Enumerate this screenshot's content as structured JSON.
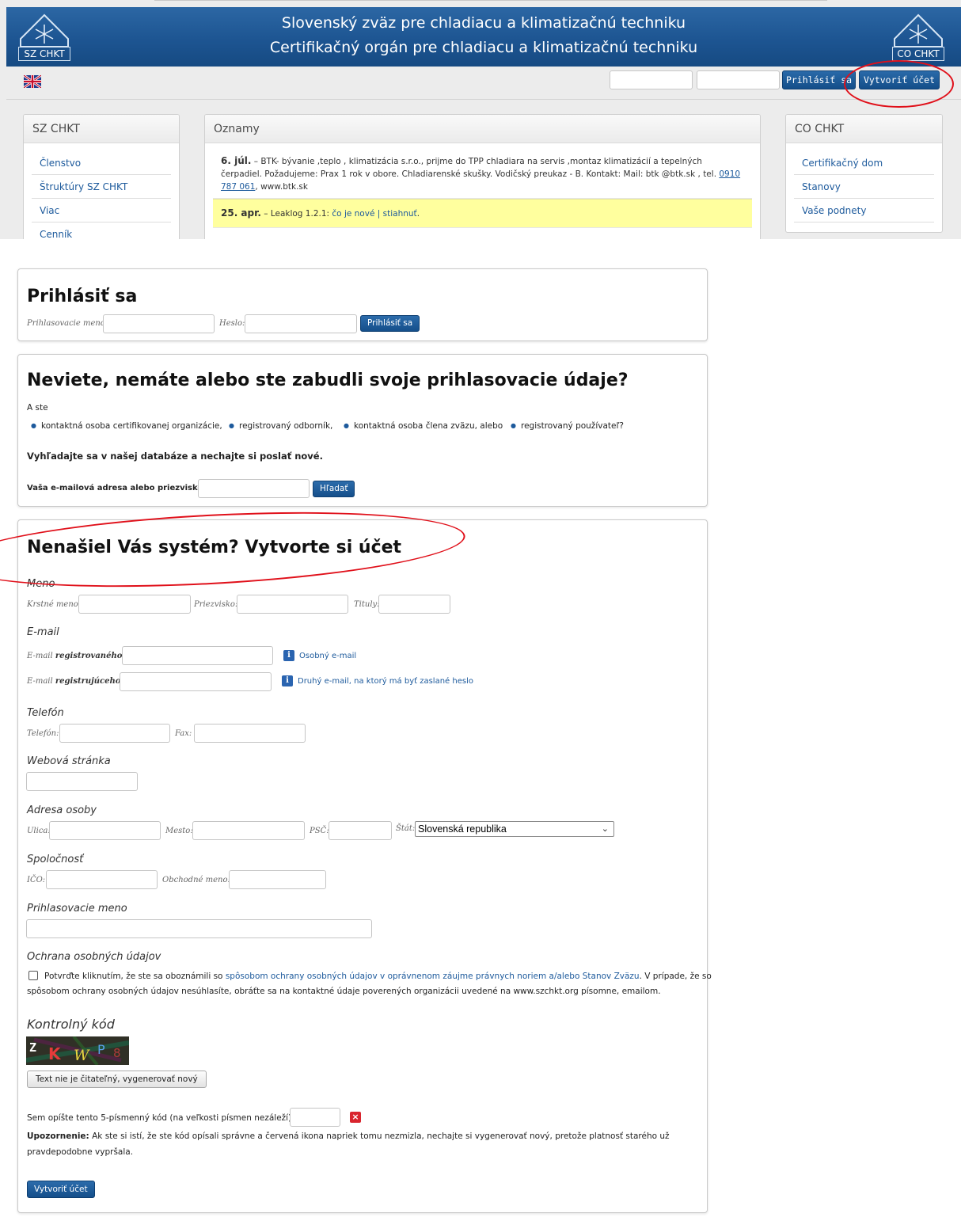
{
  "header": {
    "title_line1": "Slovenský zväz pre chladiacu a klimatizačnú techniku",
    "title_line2": "Certifikačný orgán pre chladiacu a klimatizačnú techniku",
    "logo_left_label": "SZ CHKT",
    "logo_right_label": "CO CHKT",
    "login_button": "Prihlásiť sa",
    "create_account_button": "Vytvoriť účet"
  },
  "sidebar_left": {
    "title": "SZ CHKT",
    "items": [
      "Členstvo",
      "Štruktúry SZ CHKT",
      "Viac",
      "Cenník"
    ]
  },
  "news": {
    "title": "Oznamy",
    "item1_date": "6. júl.",
    "item1_text": "– BTK- bývanie ,teplo , klimatizácia s.r.o., prijme do TPP chladiara na servis ,montaz klimatizácií a tepelných čerpadiel. Požadujeme: Prax 1 rok v obore. Chladiarenské skušky. Vodičský preukaz - B. Kontakt: Mail: btk @btk.sk , tel.",
    "item1_phone": "0910 787 061",
    "item1_tail": ", www.btk.sk",
    "item2_date": "25. apr.",
    "item2_text": "– Leaklog 1.2.1:",
    "item2_link1": "čo je nové",
    "item2_sep": "|",
    "item2_link2": "stiahnuť",
    "item2_end": "."
  },
  "sidebar_right": {
    "title": "CO CHKT",
    "items": [
      "Certifikačný dom",
      "Stanovy",
      "Vaše podnety"
    ]
  },
  "login": {
    "heading": "Prihlásiť sa",
    "username_label": "Prihlasovacie meno:",
    "password_label": "Heslo:",
    "button": "Prihlásiť sa"
  },
  "recover": {
    "heading": "Neviete, nemáte alebo ste zabudli svoje prihlasovacie údaje?",
    "intro": "A ste",
    "options": [
      "kontaktná osoba certifikovanej organizácie,",
      "registrovaný odborník,",
      "kontaktná osoba člena zväzu, alebo",
      "registrovaný používateľ?"
    ],
    "prompt": "Vyhľadajte sa v našej databáze a nechajte si poslať nové.",
    "field_label": "Vaša e-mailová adresa alebo priezvisko:",
    "button": "Hľadať"
  },
  "register": {
    "heading": "Nenašiel Vás systém? Vytvorte si účet",
    "name_section": "Meno",
    "first_name": "Krstné meno:",
    "last_name": "Priezvisko:",
    "titles": "Tituly:",
    "email_section": "E-mail",
    "email_reg_prefix": "E-mail",
    "email_reg_bold": "registrovaného:",
    "email_reg_hint": "Osobný e-mail",
    "email_regr_prefix": "E-mail",
    "email_regr_bold": "registrujúceho:",
    "email_regr_hint": "Druhý e-mail, na ktorý má byť zaslané heslo",
    "phone_section": "Telefón",
    "phone": "Telefón:",
    "fax": "Fax:",
    "web_section": "Webová stránka",
    "address_section": "Adresa osoby",
    "street": "Ulica:",
    "city": "Mesto:",
    "zip": "PSČ:",
    "country": "Štát:",
    "country_value": "Slovenská republika",
    "company_section": "Spoločnosť",
    "ico": "IČO:",
    "trade_name": "Obchodné meno:",
    "username_section": "Prihlasovacie meno",
    "privacy_section": "Ochrana osobných údajov",
    "privacy_text1": "Potvrďte kliknutím, že ste sa oboznámili so",
    "privacy_link": "spôsobom ochrany osobných údajov v oprávnenom záujme právnych noriem a/alebo Stanov Zväzu",
    "privacy_text2": ". V prípade, že so",
    "privacy_text3": "spôsobom ochrany osobných údajov nesúhlasíte, obráťte sa na kontaktné údaje poverených organizácii uvedené na www.szchkt.org písomne, emailom.",
    "captcha_section": "Kontrolný kód",
    "captcha_chars": [
      "Z",
      "K",
      "W",
      "P",
      "8"
    ],
    "regen_button": "Text nie je čitateľný, vygenerovať nový",
    "code_label": "Sem opíšte tento 5-písmenný kód (na veľkosti písmen nezáleží):",
    "warning_bold": "Upozornenie:",
    "warning_text1": "Ak ste si istí, že ste kód opísali správne a červená ikona napriek tomu nezmizla, nechajte si vygenerovať nový, pretože platnosť starého už",
    "warning_text2": "pravdepodobne vypršala.",
    "submit": "Vytvoriť účet"
  },
  "colors": {
    "banner": "#1d5592",
    "button": "#174f8a",
    "highlight": "#ffff9e",
    "annotation": "#e0101a",
    "link": "#1d5a9c"
  }
}
